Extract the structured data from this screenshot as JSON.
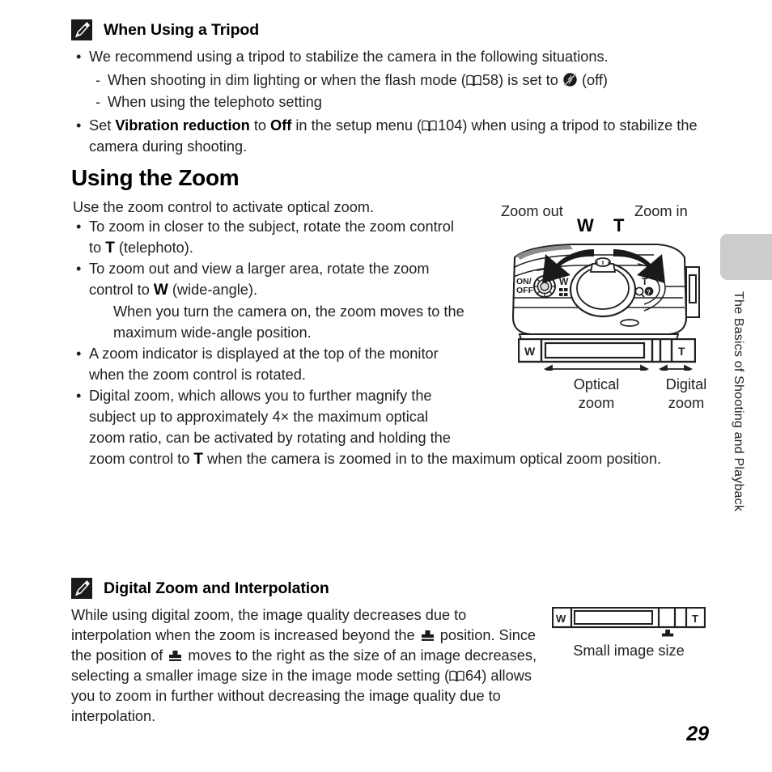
{
  "page": {
    "number": "29",
    "chapter_tab_label": "The Basics of Shooting and Playback"
  },
  "note_tripod": {
    "icon": "pencil-note-icon",
    "title": "When Using a Tripod",
    "bullet1": "We recommend using a tripod to stabilize the camera in the following situations.",
    "sub1_pre": "When shooting in dim lighting or when the flash mode (",
    "sub1_page": "58",
    "sub1_mid": ") is set to ",
    "sub1_post": " (off)",
    "sub2": "When using the telephoto setting",
    "bullet2_pre": "Set ",
    "bullet2_bold1": "Vibration reduction",
    "bullet2_mid1": " to ",
    "bullet2_bold2": "Off",
    "bullet2_mid2": " in the setup menu (",
    "bullet2_page": "104",
    "bullet2_post": ") when using a tripod to stabilize the",
    "bullet2_line2": "camera during shooting."
  },
  "section": {
    "heading": "Using the Zoom",
    "intro": "Use the zoom control to activate optical zoom.",
    "b1_l1": "To zoom in closer to the subject, rotate the zoom control",
    "b1_l2_pre": "to ",
    "b1_l2_sym": "T",
    "b1_l2_post": " (telephoto).",
    "b2_l1": "To zoom out and view a larger area, rotate the zoom",
    "b2_l2_pre": "control to ",
    "b2_l2_sym": "W",
    "b2_l2_post": " (wide-angle).",
    "b2_l3": "When you turn the camera on, the zoom moves to the",
    "b2_l4": "maximum wide-angle position.",
    "b3_l1": "A zoom indicator is displayed at the top of the monitor",
    "b3_l2": "when the zoom control is rotated.",
    "b4_l1": "Digital zoom, which allows you to further magnify the",
    "b4_l2": "subject up to approximately 4× the maximum optical",
    "b4_l3": "zoom ratio, can be activated by rotating and holding the",
    "b4_l4_pre": "zoom control to ",
    "b4_l4_sym": "T",
    "b4_l4_post": " when the camera is zoomed in to the maximum optical zoom position."
  },
  "camera_figure": {
    "zoom_out_label": "Zoom out",
    "zoom_in_label": "Zoom in",
    "w_mark": "W",
    "t_mark": "T",
    "power_label_line1": "ON/",
    "power_label_line2": "OFF",
    "body_w_mark": "W",
    "body_t_mark": "T"
  },
  "zoom_bar_figure": {
    "w_label": "W",
    "t_label": "T",
    "optical_line1": "Optical",
    "optical_line2": "zoom",
    "digital_line1": "Digital",
    "digital_line2": "zoom"
  },
  "note_digital": {
    "icon": "pencil-note-icon",
    "title": "Digital Zoom and Interpolation",
    "l1": "While using digital zoom, the image quality decreases due to",
    "l2_pre": "interpolation when the zoom is increased beyond the ",
    "l2_post": " position. Since",
    "l3_pre": "the position of ",
    "l3_post": " moves to the right as the size of an image decreases,",
    "l4_pre": "selecting a smaller image size in the image mode setting (",
    "l4_page": "64",
    "l4_post": ") allows",
    "l5": "you to zoom in further without decreasing the image quality due to",
    "l6": "interpolation."
  },
  "small_image_figure": {
    "w_label": "W",
    "t_label": "T",
    "caption": "Small image size"
  },
  "colors": {
    "text": "#231f20",
    "heading": "#000000",
    "tab_gray": "#cccccc",
    "icon_black": "#1a1a1a"
  }
}
